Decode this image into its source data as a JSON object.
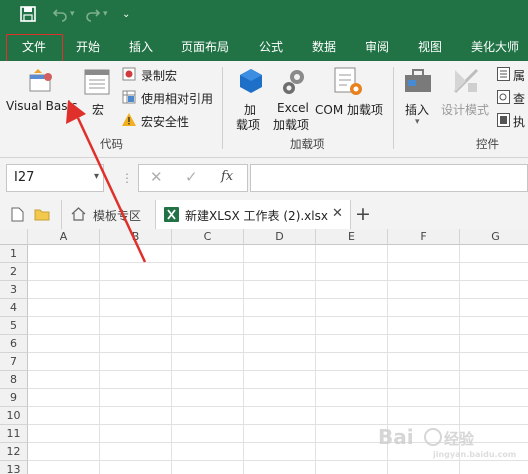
{
  "menubar": {
    "tabs": [
      "文件",
      "开始",
      "插入",
      "页面布局",
      "公式",
      "数据",
      "审阅",
      "视图",
      "美化大师"
    ]
  },
  "ribbon": {
    "visual_basic": "Visual Basic",
    "macro": "宏",
    "record_macro": "录制宏",
    "relative_ref": "使用相对引用",
    "macro_security": "宏安全性",
    "group_code": "代码",
    "addins": "加\n载项",
    "addins_line1": "加",
    "addins_line2": "载项",
    "excel_addins_line1": "Excel",
    "excel_addins_line2": "加载项",
    "com_addins": "COM 加载项",
    "group_addins": "加载项",
    "insert": "插入",
    "design_mode": "设计模式",
    "properties": "属",
    "view_code": "查",
    "run_dialog": "执",
    "group_controls": "控件"
  },
  "formula_bar": {
    "namebox": "I27",
    "fx": "fx",
    "value": ""
  },
  "doc_tabs": {
    "template_area": "模板专区",
    "file_tab": "新建XLSX 工作表 (2).xlsx"
  },
  "grid": {
    "columns": [
      "A",
      "B",
      "C",
      "D",
      "E",
      "F",
      "G"
    ],
    "rows": [
      "1",
      "2",
      "3",
      "4",
      "5",
      "6",
      "7",
      "8",
      "9",
      "10",
      "11",
      "12",
      "13"
    ]
  },
  "colors": {
    "excel_green": "#217346",
    "highlight_red": "#e0302c"
  }
}
